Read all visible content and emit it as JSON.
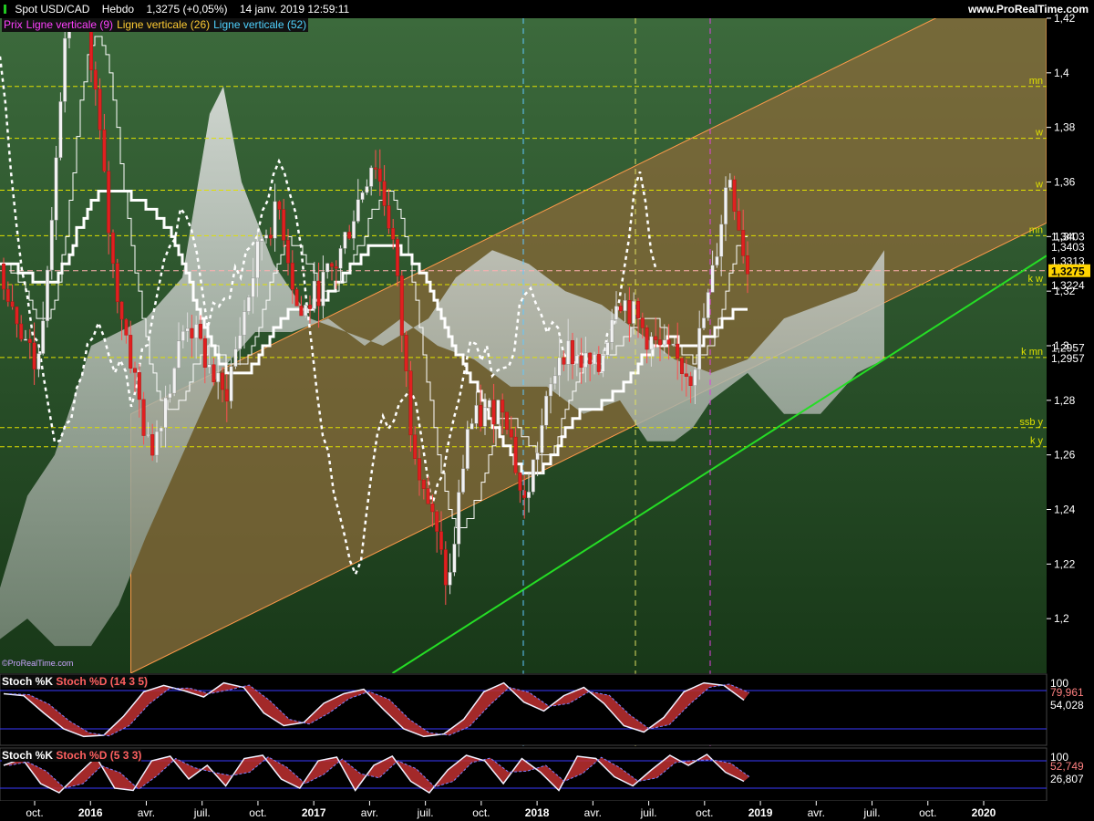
{
  "header": {
    "instrument": "Spot USD/CAD",
    "timeframe": "Hebdo",
    "last": "1,3275 (+0,05%)",
    "datetime": "14 janv. 2019 12:59:11",
    "site": "www.ProRealTime.com"
  },
  "legend": [
    {
      "label": "Prix",
      "color": "#ff40ff"
    },
    {
      "label": "Ligne verticale (9)",
      "color": "#ff40ff"
    },
    {
      "label": "Ligne verticale (26)",
      "color": "#ffcc33"
    },
    {
      "label": "Ligne verticale (52)",
      "color": "#4fd2ff"
    }
  ],
  "watermark": "©ProRealTime.com",
  "x_axis_labels": [
    "oct.",
    "2016",
    "avr.",
    "juil.",
    "oct.",
    "2017",
    "avr.",
    "juil.",
    "oct.",
    "2018",
    "avr.",
    "juil.",
    "oct.",
    "2019",
    "avr.",
    "juil.",
    "oct.",
    "2020"
  ],
  "colors": {
    "bg_dark": "#183818",
    "bg_light": "#3c6a3c",
    "channel": "#8a6a3a",
    "up": "#f2f2f2",
    "down": "#e02020",
    "cloud": "#d8d8d8",
    "trend": "#25dd25",
    "level": "#e0e000",
    "vline9": "#e040e0",
    "vline26": "#e0e060",
    "vline52": "#60c8ff"
  },
  "chart_data": [
    {
      "type": "candlestick",
      "title": "Spot USD/CAD",
      "x_range": [
        "2015-09",
        "2020-05"
      ],
      "ylim": [
        1.18,
        1.42
      ],
      "y_ticks": [
        "1,42",
        "1,4",
        "1,38",
        "1,36",
        "1,34",
        "1,32",
        "1,3",
        "1,28",
        "1,26",
        "1,24",
        "1,22",
        "1,2"
      ],
      "price_path": [
        [
          "2015-09",
          1.33
        ],
        [
          "2015-11",
          1.29
        ],
        [
          "2016-01",
          1.45
        ],
        [
          "2016-02",
          1.4
        ],
        [
          "2016-03",
          1.33
        ],
        [
          "2016-05",
          1.26
        ],
        [
          "2016-07",
          1.31
        ],
        [
          "2016-09",
          1.28
        ],
        [
          "2016-11",
          1.34
        ],
        [
          "2016-12",
          1.35
        ],
        [
          "2017-01",
          1.31
        ],
        [
          "2017-03",
          1.33
        ],
        [
          "2017-05",
          1.37
        ],
        [
          "2017-06",
          1.34
        ],
        [
          "2017-07",
          1.27
        ],
        [
          "2017-09",
          1.21
        ],
        [
          "2017-10",
          1.27
        ],
        [
          "2017-12",
          1.28
        ],
        [
          "2018-01",
          1.24
        ],
        [
          "2018-02",
          1.27
        ],
        [
          "2018-03",
          1.3
        ],
        [
          "2018-05",
          1.29
        ],
        [
          "2018-06",
          1.32
        ],
        [
          "2018-07",
          1.31
        ],
        [
          "2018-08",
          1.3
        ],
        [
          "2018-10",
          1.29
        ],
        [
          "2018-11",
          1.32
        ],
        [
          "2018-12",
          1.365
        ],
        [
          "2019-01",
          1.3275
        ]
      ],
      "levels": [
        {
          "label": "mn",
          "value": 1.395
        },
        {
          "label": "w",
          "value": 1.376
        },
        {
          "label": "w",
          "value": 1.357
        },
        {
          "label": "mn",
          "value": 1.3403
        },
        {
          "label": "k w",
          "value": 1.3224
        },
        {
          "label": "k mn",
          "value": 1.2957
        },
        {
          "label": "ssb y",
          "value": 1.27
        },
        {
          "label": "k y",
          "value": 1.263
        }
      ],
      "price_tags": [
        {
          "value": "1,3403",
          "y": 1.3403
        },
        {
          "value": "1,3403",
          "y": 1.3365
        },
        {
          "value": "1,3313",
          "y": 1.3313
        },
        {
          "value": "1,3275",
          "y": 1.3275,
          "highlight": true
        },
        {
          "value": "1,3224",
          "y": 1.3224
        },
        {
          "value": "1,2957",
          "y": 1.2995
        },
        {
          "value": "1,2957",
          "y": 1.2957
        }
      ],
      "vertical_lines": [
        {
          "label": "Ligne verticale (52)",
          "date": "2018-01"
        },
        {
          "label": "Ligne verticale (26)",
          "date": "2018-07"
        },
        {
          "label": "Ligne verticale (9)",
          "date": "2018-11"
        }
      ],
      "channel": {
        "lower_start": [
          "2016-04",
          1.18
        ],
        "lower_end": [
          "2020-05",
          1.345
        ],
        "width": 0.095
      },
      "trendline": {
        "start": [
          "2017-06",
          1.18
        ],
        "end": [
          "2020-05",
          1.333
        ]
      }
    },
    {
      "type": "line",
      "series": [
        {
          "name": "Stoch %K"
        },
        {
          "name": "Stoch %D (14 3 5)"
        }
      ],
      "ylim": [
        0,
        100
      ],
      "tags": [
        "100",
        "79,961",
        "54,028"
      ],
      "k_path": [
        75,
        72,
        45,
        20,
        8,
        10,
        40,
        78,
        88,
        80,
        70,
        92,
        85,
        45,
        25,
        30,
        60,
        75,
        82,
        50,
        20,
        8,
        12,
        35,
        78,
        92,
        62,
        48,
        72,
        85,
        60,
        25,
        15,
        38,
        78,
        92,
        88,
        65
      ]
    },
    {
      "type": "line",
      "series": [
        {
          "name": "Stoch %K"
        },
        {
          "name": "Stoch %D (5 3 3)"
        }
      ],
      "ylim": [
        0,
        100
      ],
      "tags": [
        "100",
        "52,749",
        "26,807"
      ],
      "k_path": [
        70,
        85,
        30,
        10,
        50,
        88,
        20,
        15,
        80,
        90,
        40,
        70,
        25,
        85,
        92,
        40,
        20,
        80,
        88,
        15,
        70,
        90,
        35,
        10,
        60,
        92,
        80,
        30,
        85,
        55,
        15,
        90,
        85,
        45,
        25,
        60,
        92,
        70,
        94,
        55,
        35
      ]
    }
  ]
}
